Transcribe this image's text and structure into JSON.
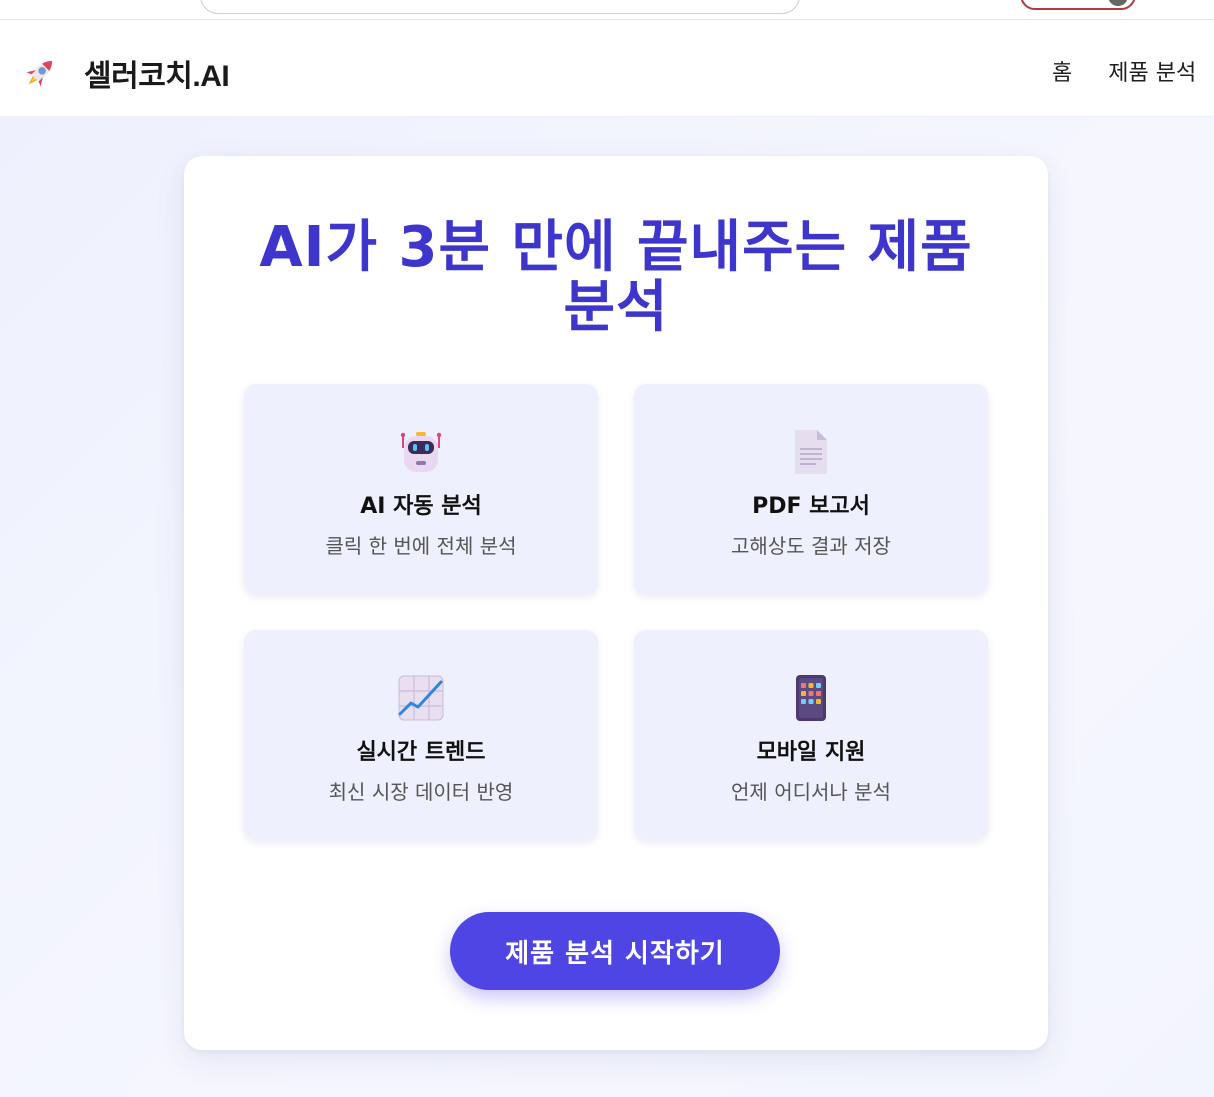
{
  "header": {
    "brand_name": "셀러코치.AI",
    "brand_icon": "rocket-icon",
    "nav": [
      {
        "label": "홈"
      },
      {
        "label": "제품 분석"
      }
    ]
  },
  "hero": {
    "title": "AI가 3분 만에 끝내주는 제품 분석"
  },
  "features": [
    {
      "icon": "robot-icon",
      "title": "AI 자동 분석",
      "desc": "클릭 한 번에 전체 분석"
    },
    {
      "icon": "document-icon",
      "title": "PDF 보고서",
      "desc": "고해상도 결과 저장"
    },
    {
      "icon": "chart-increasing-icon",
      "title": "실시간 트렌드",
      "desc": "최신 시장 데이터 반영"
    },
    {
      "icon": "mobile-phone-icon",
      "title": "모바일 지원",
      "desc": "언제 어디서나 분석"
    }
  ],
  "cta": {
    "label": "제품 분석 시작하기"
  },
  "colors": {
    "accent": "#4f45e4",
    "title": "#3e35cc",
    "feature_bg": "#eef1fd"
  }
}
